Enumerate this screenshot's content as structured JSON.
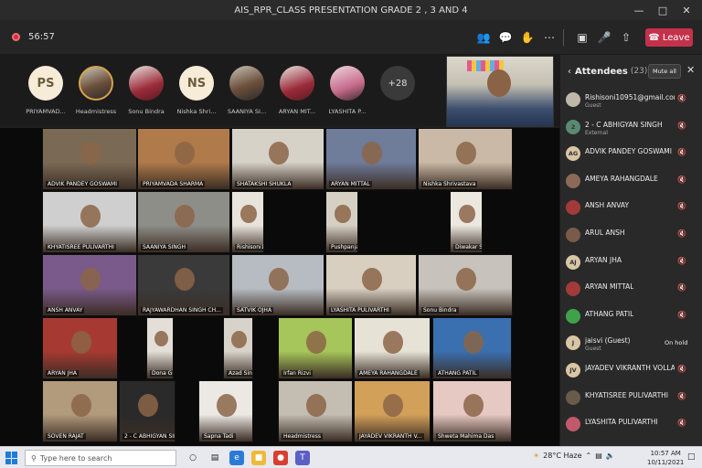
{
  "window": {
    "title": "AIS_RPR_CLASS PRESENTATION GRADE 2 , 3 AND 4"
  },
  "toolbar": {
    "timer": "56:57",
    "leave_label": "Leave"
  },
  "strip": {
    "avatars": [
      {
        "initials": "PS",
        "name": "PRIYAMVAD..."
      },
      {
        "initials": "",
        "name": "Headmistress"
      },
      {
        "initials": "",
        "name": "Sonu Bindra"
      },
      {
        "initials": "NS",
        "name": "Nishka Shri..."
      },
      {
        "initials": "",
        "name": "SAANIYA SI..."
      },
      {
        "initials": "",
        "name": "ARYAN MIT..."
      },
      {
        "initials": "",
        "name": "LYASHITA P..."
      }
    ],
    "more": "+28"
  },
  "grid": {
    "tiles": [
      "ADVIK PANDEY GOSWAMI",
      "PRIYAMVADA SHARMA",
      "SHATAKSHI SHUKLA",
      "ARYAN MITTAL",
      "Nishka Shrivastava",
      "KHYATISREE PULIVARTHI",
      "SAANIYA SINGH",
      "Rishisoni10951@gmail.com",
      "Pushpanjali Chhatter",
      "Diwakar Sarkar",
      "ANSH ANVAY",
      "RAJYAWARDHAN SINGH CH...",
      "SATVIK OJHA",
      "LYASHITA PULIVARTHI",
      "Sonu Bindra",
      "ARYAN JHA",
      "Dona Guha",
      "Azad Singh",
      "Irfan Rizvi",
      "AMEYA RAHANGDALE",
      "ATHANG PATIL",
      "SOVEN RAJAT",
      "2 - C ABHIGYAN SINGH",
      "Sapna Tadi",
      "Headmistress",
      "JAYADEV VIKRANTH V...",
      "Shweta Mahima Das"
    ]
  },
  "attendees": {
    "title": "Attendees",
    "count": "(23)",
    "mute_all": "Mute all",
    "list": [
      {
        "initials": "",
        "name": "Rishisoni10951@gmail.com (...",
        "sub": "Guest"
      },
      {
        "initials": "2",
        "name": "2 - C ABHIGYAN SINGH",
        "sub": "External"
      },
      {
        "initials": "AG",
        "name": "ADVIK PANDEY GOSWAMI",
        "sub": ""
      },
      {
        "initials": "",
        "name": "AMEYA RAHANGDALE",
        "sub": ""
      },
      {
        "initials": "",
        "name": "ANSH ANVAY",
        "sub": ""
      },
      {
        "initials": "",
        "name": "ARUL ANSH",
        "sub": ""
      },
      {
        "initials": "AJ",
        "name": "ARYAN JHA",
        "sub": ""
      },
      {
        "initials": "",
        "name": "ARYAN MITTAL",
        "sub": ""
      },
      {
        "initials": "",
        "name": "ATHANG PATIL",
        "sub": ""
      },
      {
        "initials": "J",
        "name": "jaisvi (Guest)",
        "sub": "Guest",
        "status": "On hold"
      },
      {
        "initials": "JV",
        "name": "JAYADEV VIKRANTH VOLLALA",
        "sub": ""
      },
      {
        "initials": "",
        "name": "KHYATISREE PULIVARTHI",
        "sub": ""
      },
      {
        "initials": "",
        "name": "LYASHITA PULIVARTHI",
        "sub": ""
      }
    ]
  },
  "taskbar": {
    "search_placeholder": "Type here to search",
    "weather": "28°C  Haze",
    "time": "10:57 AM",
    "date": "10/11/2021"
  },
  "colors": {
    "leave": "#c4314b",
    "panel": "#292929",
    "background": "#1f1f1f"
  }
}
